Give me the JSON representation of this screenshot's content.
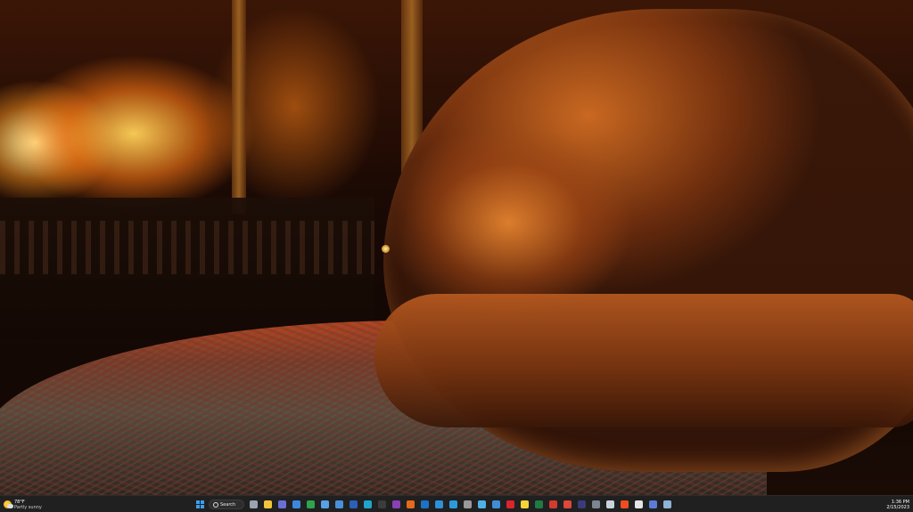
{
  "wallpaper": {
    "subject": "dog-by-fireplace"
  },
  "taskbar": {
    "weather": {
      "temperature": "78°F",
      "condition": "Partly sunny",
      "icon": "partly-sunny-icon"
    },
    "search": {
      "label": "Search"
    },
    "apps": [
      {
        "name": "start-button",
        "icon": "windows-start-icon"
      },
      {
        "name": "search-box",
        "icon": "search-icon"
      },
      {
        "name": "task-view",
        "icon": "task-view-icon",
        "color": "#9aa4b0"
      },
      {
        "name": "file-explorer",
        "icon": "folder-icon",
        "color": "#f2c43a"
      },
      {
        "name": "app-teams",
        "icon": "teams-icon",
        "color": "#6a6fd8"
      },
      {
        "name": "app-store",
        "icon": "store-icon",
        "color": "#3d86e0"
      },
      {
        "name": "app-chrome",
        "icon": "chrome-icon",
        "color": "#2ea44f"
      },
      {
        "name": "app-notepad",
        "icon": "notepad-icon",
        "color": "#58a0e8"
      },
      {
        "name": "app-remote",
        "icon": "remote-desktop-icon",
        "color": "#4a90d9"
      },
      {
        "name": "app-word",
        "icon": "word-icon",
        "color": "#2b5fb8"
      },
      {
        "name": "app-edge",
        "icon": "edge-icon",
        "color": "#1fa4c9"
      },
      {
        "name": "app-terminal",
        "icon": "terminal-icon",
        "color": "#3c3c3c"
      },
      {
        "name": "app-onenote",
        "icon": "onenote-icon",
        "color": "#8a3fb5"
      },
      {
        "name": "app-firefox",
        "icon": "firefox-icon",
        "color": "#e56a1c"
      },
      {
        "name": "app-outlook",
        "icon": "outlook-icon",
        "color": "#1b72c8"
      },
      {
        "name": "app-photos",
        "icon": "photos-icon",
        "color": "#2f8fd9"
      },
      {
        "name": "app-vscode",
        "icon": "vscode-icon",
        "color": "#2a9bdc"
      },
      {
        "name": "app-headset",
        "icon": "headset-icon",
        "color": "#9a9a9a"
      },
      {
        "name": "app-calculator",
        "icon": "calculator-icon",
        "color": "#4fb2e5"
      },
      {
        "name": "app-mail",
        "icon": "mail-icon",
        "color": "#3e8ed6"
      },
      {
        "name": "app-opera",
        "icon": "opera-icon",
        "color": "#d9262c"
      },
      {
        "name": "app-sticky",
        "icon": "sticky-notes-icon",
        "color": "#f4d339"
      },
      {
        "name": "app-excel",
        "icon": "excel-icon",
        "color": "#1f7a43"
      },
      {
        "name": "app-acrobat",
        "icon": "acrobat-icon",
        "color": "#d63a2e"
      },
      {
        "name": "app-pdf",
        "icon": "pdf-icon",
        "color": "#e0463a"
      },
      {
        "name": "app-affinity",
        "icon": "affinity-icon",
        "color": "#3b3a7a"
      },
      {
        "name": "app-device",
        "icon": "device-icon",
        "color": "#7d8590"
      },
      {
        "name": "app-file",
        "icon": "file-icon",
        "color": "#c9d3de"
      },
      {
        "name": "app-brave",
        "icon": "brave-icon",
        "color": "#f04d1e"
      },
      {
        "name": "app-snip",
        "icon": "snipping-tool-icon",
        "color": "#e5e5e5"
      },
      {
        "name": "app-connect",
        "icon": "connect-icon",
        "color": "#5b7bd6"
      },
      {
        "name": "app-settings",
        "icon": "settings-icon",
        "color": "#8fb3d9"
      }
    ],
    "clock": {
      "time": "1:36 PM",
      "date": "2/15/2023"
    }
  }
}
